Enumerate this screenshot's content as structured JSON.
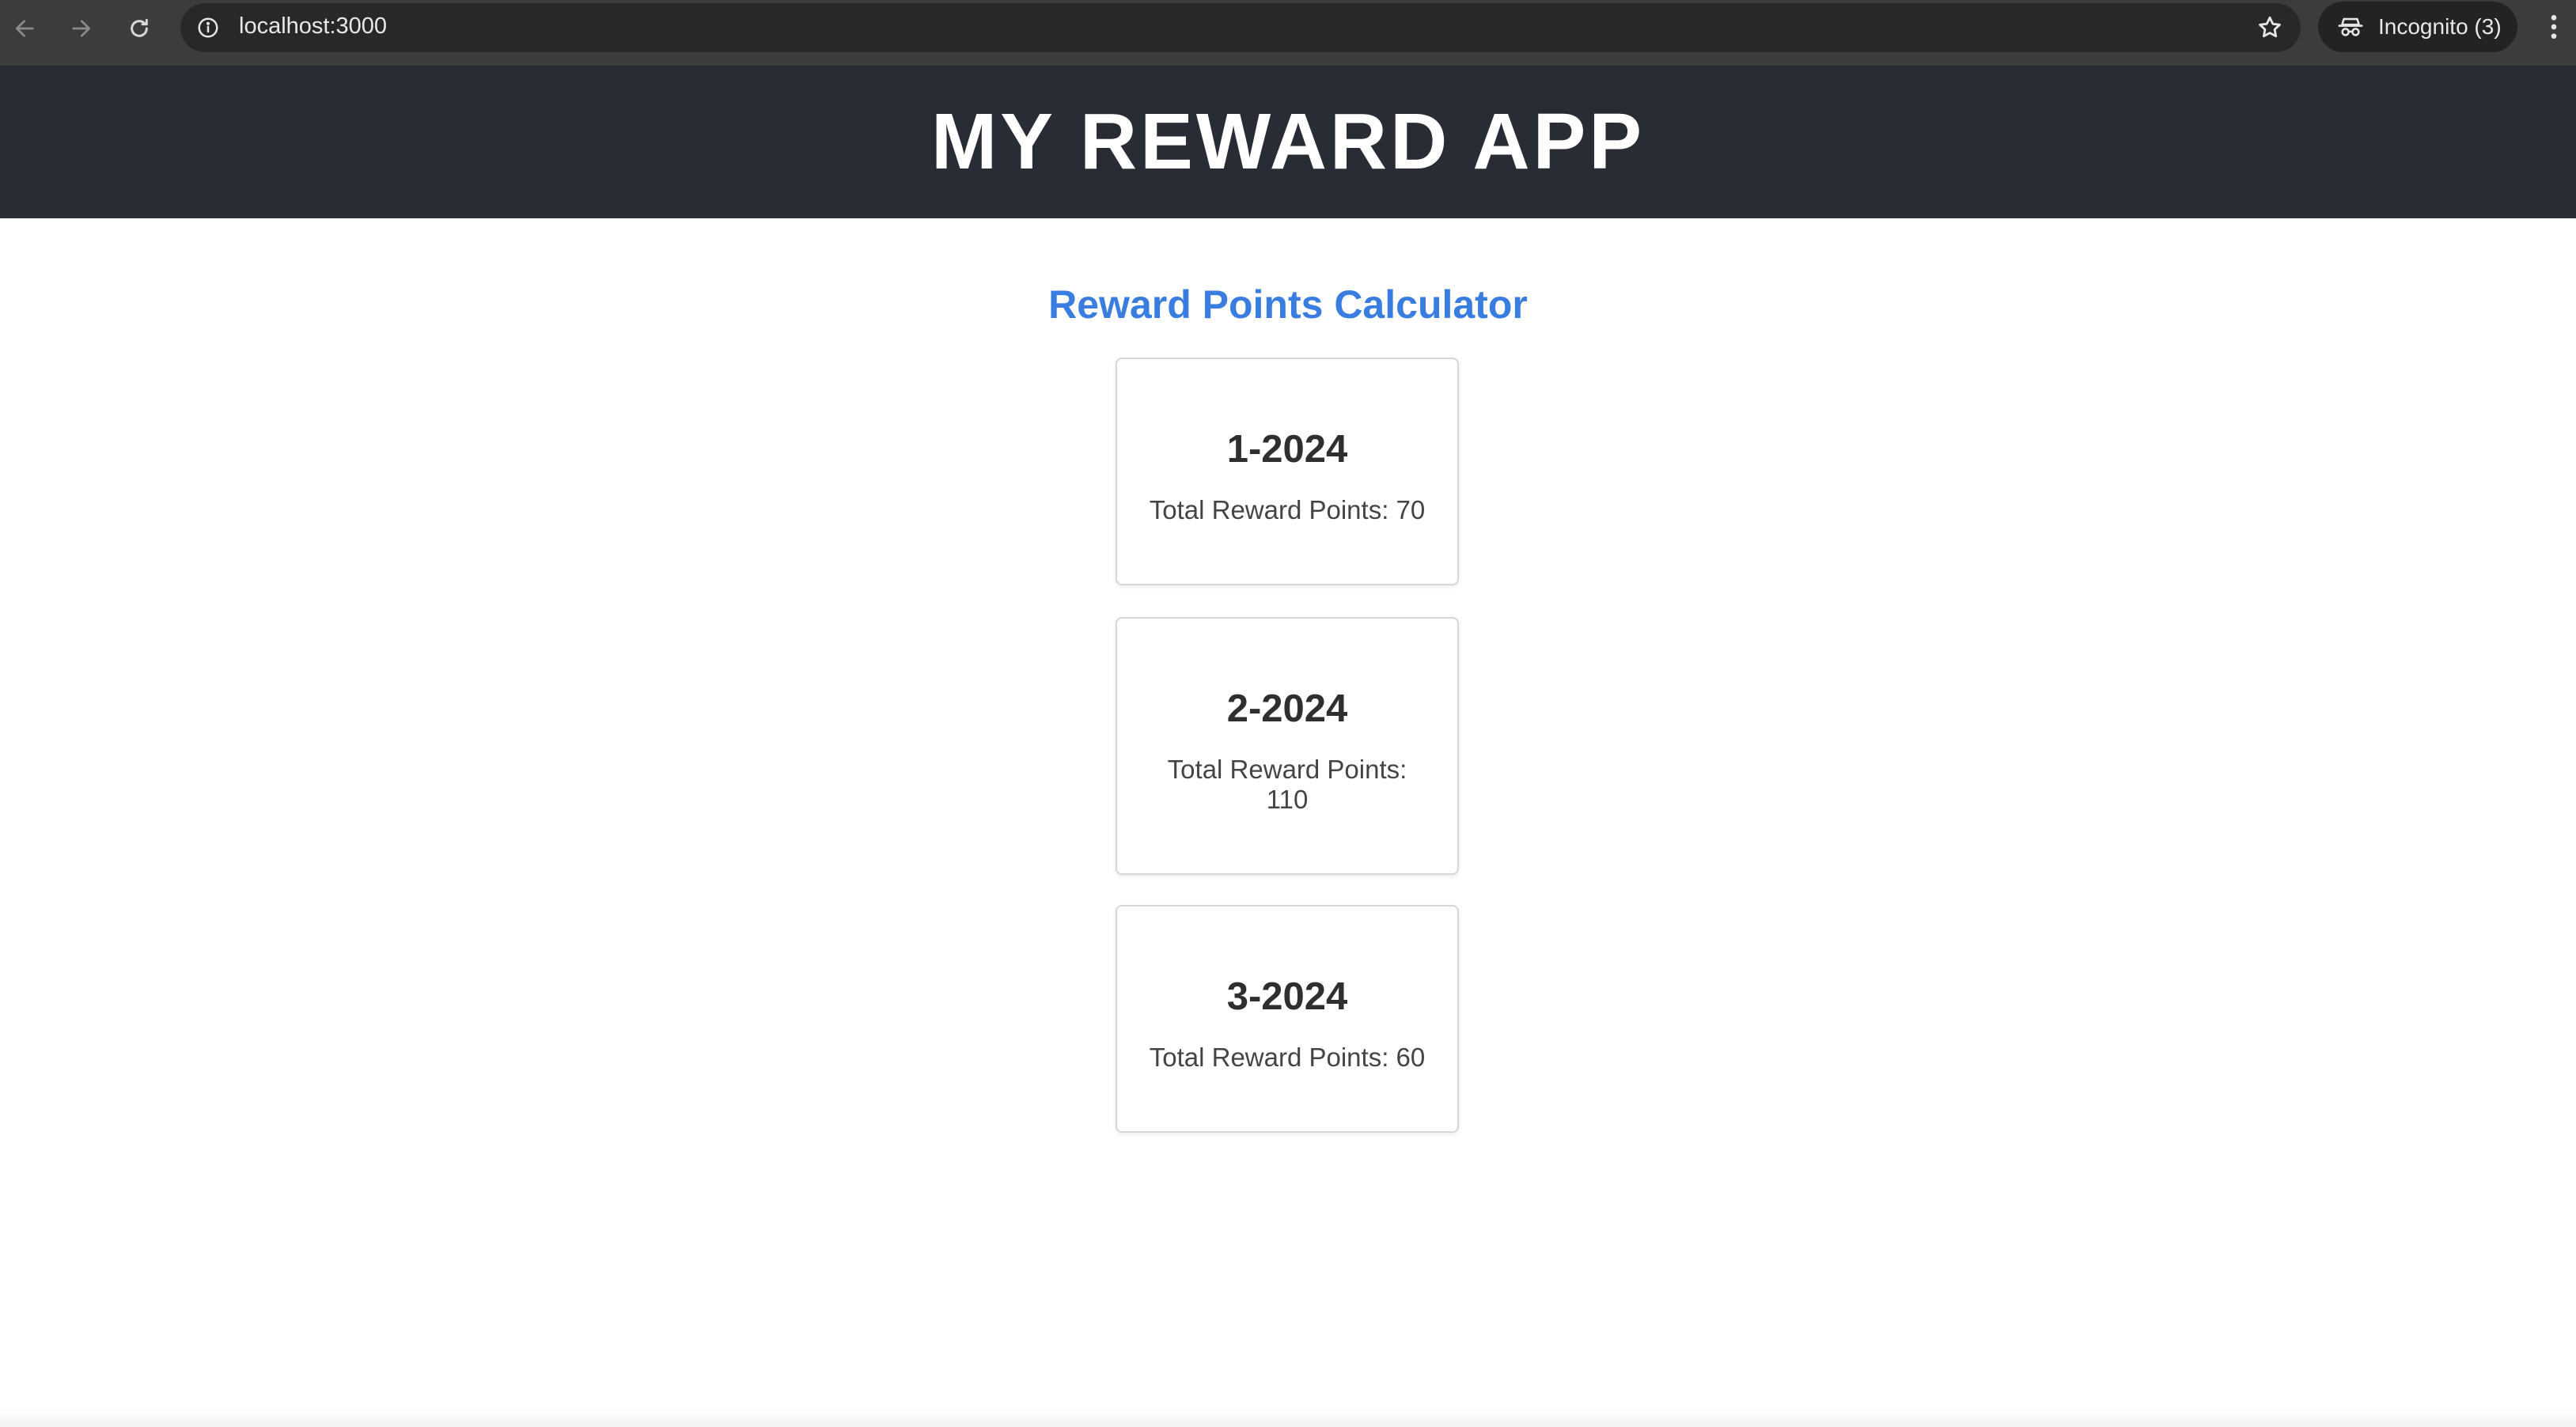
{
  "browser": {
    "url": "localhost:3000",
    "incognito_label": "Incognito (3)",
    "icons": [
      "back-arrow-icon",
      "forward-arrow-icon",
      "reload-icon",
      "info-icon",
      "star-icon",
      "incognito-icon",
      "more-vert-icon"
    ]
  },
  "app": {
    "title": "MY REWARD APP",
    "header_color": "#282c34"
  },
  "main": {
    "section_title": "Reward Points Calculator",
    "accent_color": "#3a7de0",
    "cards": [
      {
        "month": "1-2024",
        "points_text": "Total Reward Points: 70"
      },
      {
        "month": "2-2024",
        "points_text": "Total Reward Points: 110"
      },
      {
        "month": "3-2024",
        "points_text": "Total Reward Points: 60"
      }
    ]
  }
}
